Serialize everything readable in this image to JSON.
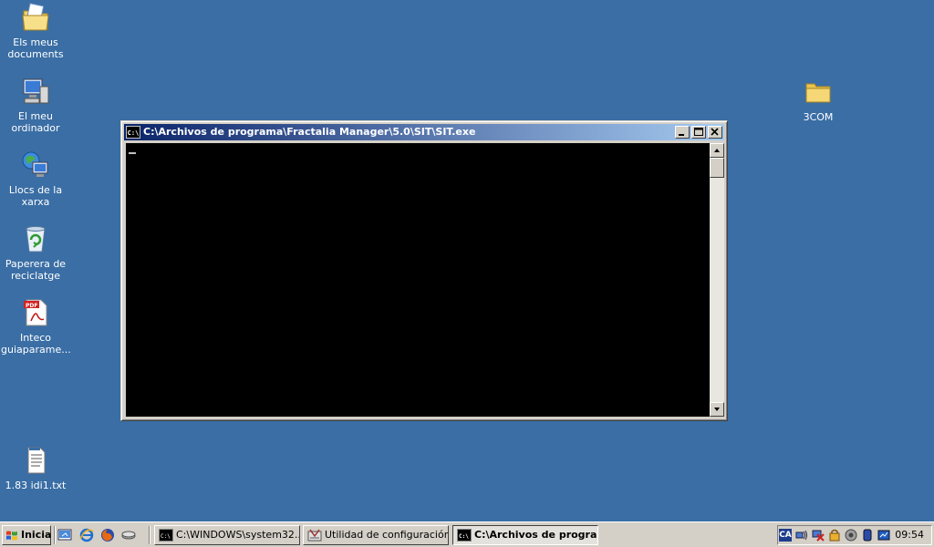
{
  "desktop": {
    "icons": [
      {
        "label": "Els meus documents",
        "icon": "my-documents-icon"
      },
      {
        "label": "El meu ordinador",
        "icon": "my-computer-icon"
      },
      {
        "label": "Llocs de la xarxa",
        "icon": "network-places-icon"
      },
      {
        "label": "Paperera de reciclatge",
        "icon": "recycle-bin-icon"
      },
      {
        "label": "Inteco guiaparame...",
        "icon": "pdf-file-icon"
      },
      {
        "label": "1.83 idi1.txt",
        "icon": "text-file-icon"
      },
      {
        "label": "3COM",
        "icon": "folder-icon"
      }
    ]
  },
  "console_window": {
    "title": "C:\\Archivos de programa\\Fractalia Manager\\5.0\\SIT\\SIT.exe",
    "icon_text": "C:\\"
  },
  "taskbar": {
    "start_label": "Inicia",
    "quick_launch": [
      "show-desktop-icon",
      "internet-explorer-icon",
      "firefox-icon",
      "network-tool-icon"
    ],
    "tasks": [
      {
        "label": "C:\\WINDOWS\\system32...",
        "icon": "console-icon",
        "active": false
      },
      {
        "label": "Utilidad de configuración ...",
        "icon": "config-utility-icon",
        "active": false
      },
      {
        "label": "C:\\Archivos de progra...",
        "icon": "console-icon",
        "active": true
      }
    ],
    "tray_text": "CA",
    "clock": "09:54"
  },
  "colors": {
    "desktop": "#3a6ea5",
    "title_active_start": "#0a246a",
    "title_active_end": "#a6caf0",
    "face": "#d4d0c8"
  }
}
